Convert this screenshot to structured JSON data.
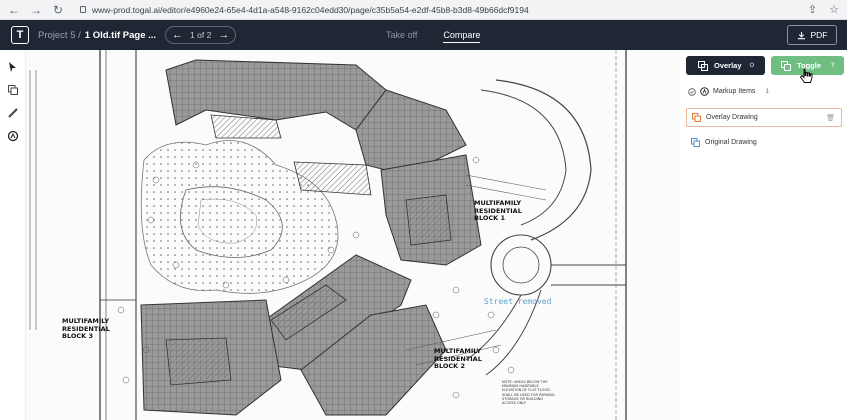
{
  "browser": {
    "url": "www-prod.togal.ai/editor/e4960e24-65e4-4d1a-a548-9162c04edd30/page/c35b5a54-e2df-45b8-b3d8-49b66dcf9194"
  },
  "header": {
    "logo": "T",
    "project": "Project 5 /",
    "file": "1 Old.tif Page ...",
    "pager": "1 of 2",
    "modes": [
      "Take off",
      "Compare"
    ],
    "active_mode": "Compare",
    "pdf_label": "PDF"
  },
  "panel": {
    "overlay_label": "Overlay",
    "overlay_key": "O",
    "toggle_label": "Toggle",
    "toggle_key": "T",
    "markup_label": "Markup Items",
    "markup_count": "1",
    "layers": [
      "Overlay Drawing",
      "Original Drawing"
    ],
    "overlay_color": "#e07b3a",
    "original_color": "#4a8fd6"
  },
  "drawing": {
    "labels": {
      "block1": "MULTIFAMILY\nRESIDENTIAL\nBLOCK 1",
      "block2": "MULTIFAMILY\nRESIDENTIAL\nBLOCK 2",
      "block3": "MULTIFAMILY\nRESIDENTIAL\nBLOCK 3"
    },
    "street_note": "Street removed",
    "parking_note": "NOTE: AREAS BELOW THE MINIMUM HABITABLE ELEVATION OF FLAT FLOOD. SHALL BE USED FOR PARKING, STORAGE OR BUILDING ACCESS ONLY"
  }
}
